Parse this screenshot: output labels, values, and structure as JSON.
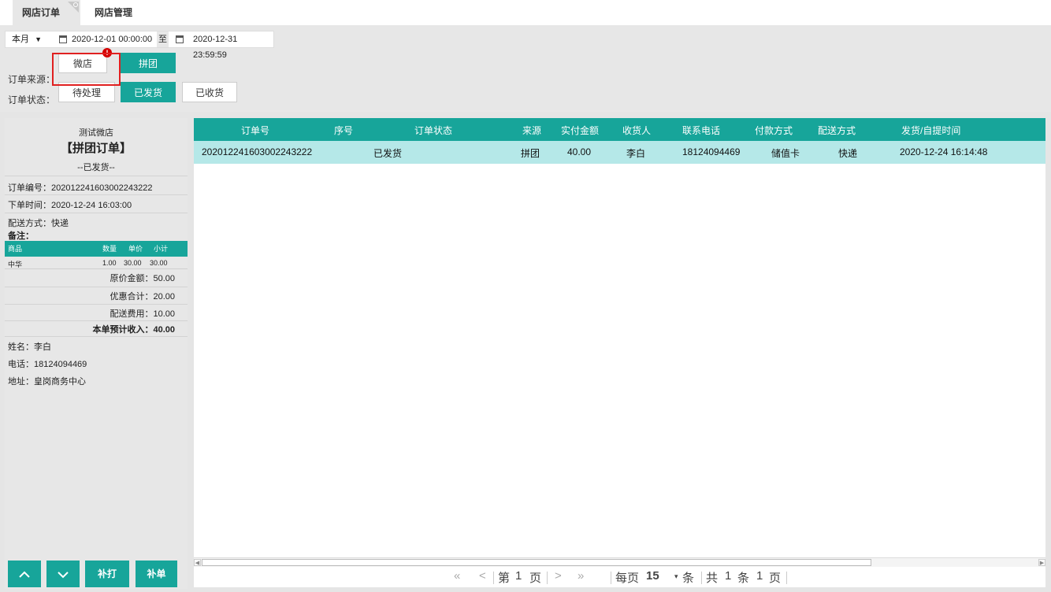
{
  "tabs": {
    "orders": "网店订单",
    "manage": "网店管理"
  },
  "filter": {
    "period": "本月",
    "start": "2020-12-01 00:00:00",
    "to": "至",
    "end": "2020-12-31 23:59:59",
    "source_label": "订单来源：",
    "sources": [
      "微店",
      "拼团"
    ],
    "source_badge": "!",
    "status_label": "订单状态：",
    "statuses": [
      "待处理",
      "已发货",
      "已收货"
    ]
  },
  "detail": {
    "shop": "测试微店",
    "type": "【拼团订单】",
    "status": "--已发货--",
    "order_no": "订单编号：202012241603002243222",
    "order_time": "下单时间：2020-12-24 16:03:00",
    "delivery": "配送方式：快递",
    "remark": "备注：",
    "goods_head": [
      "商品",
      "数量",
      "单价",
      "小计"
    ],
    "goods": [
      {
        "name": "中华",
        "qty": "1.00",
        "price": "30.00",
        "subtotal": "30.00"
      }
    ],
    "orig": "原价金额：50.00",
    "discount": "优惠合计：20.00",
    "ship_fee": "配送费用：10.00",
    "income": "本单预计收入：40.00",
    "name": "姓名：李白",
    "phone": "电话：18124094469",
    "addr": "地址：皇岗商务中心",
    "btn_reprint": "补打",
    "btn_supplement": "补单"
  },
  "table": {
    "columns": [
      "订单号",
      "序号",
      "订单状态",
      "来源",
      "实付金额",
      "收货人",
      "联系电话",
      "付款方式",
      "配送方式",
      "发货/自提时间"
    ],
    "rows": [
      [
        "202012241603002243222",
        "",
        "已发货",
        "拼团",
        "40.00",
        "李白",
        "18124094469",
        "储值卡",
        "快递",
        "2020-12-24 16:14:48"
      ]
    ]
  },
  "pager": {
    "first": "«",
    "prev": "<",
    "page_prefix": "第",
    "page": "1",
    "page_suffix": "页",
    "next": ">",
    "last": "»",
    "per_prefix": "每页",
    "per": "15",
    "per_suffix": "条",
    "total_prefix": "共",
    "total_items": "1",
    "total_mid": "条",
    "total_pages": "1",
    "total_suffix": "页"
  },
  "colors": {
    "accent": "#17a59a",
    "row_selected": "#b5e8e8",
    "highlight": "#e02020"
  }
}
